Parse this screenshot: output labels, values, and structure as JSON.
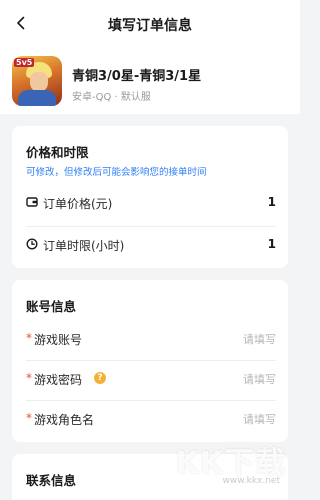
{
  "nav": {
    "title": "填写订单信息",
    "back_icon": "chevron-left-icon"
  },
  "game": {
    "icon_badge": "5v5",
    "name": "青铜3/0星-青铜3/1星",
    "subtitle": "安卓-QQ · 默认服"
  },
  "price_section": {
    "title": "价格和时限",
    "hint": "可修改，但修改后可能会影响您的接单时间",
    "rows": [
      {
        "label": "订单价格(元)",
        "value": "1",
        "icon": "wallet-icon"
      },
      {
        "label": "订单时限(小时)",
        "value": "1",
        "icon": "clock-icon"
      }
    ]
  },
  "account_section": {
    "title": "账号信息",
    "fields": [
      {
        "required_mark": "*",
        "label": "游戏账号",
        "placeholder": "请填写"
      },
      {
        "required_mark": "*",
        "label": "游戏密码",
        "placeholder": "请填写",
        "help": "?"
      },
      {
        "required_mark": "*",
        "label": "游戏角色名",
        "placeholder": "请填写"
      }
    ]
  },
  "contact_section": {
    "title": "联系信息"
  },
  "watermark": {
    "text": "KK下载",
    "url": "www.kkx.net"
  },
  "colors": {
    "hint_blue": "#2f7ff7",
    "required_red": "#e84c3d",
    "help_orange": "#f3b233",
    "background": "#f3f4f6"
  }
}
